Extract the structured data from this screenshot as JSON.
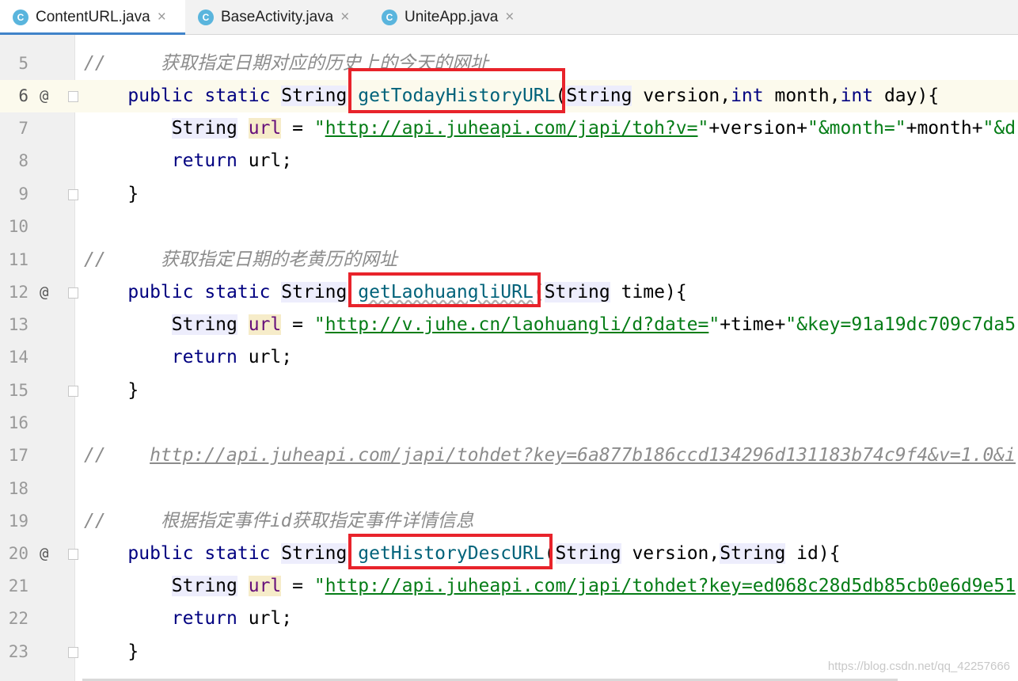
{
  "tabs": [
    {
      "label": "ContentURL.java",
      "icon": "c-class-icon",
      "active": true
    },
    {
      "label": "BaseActivity.java",
      "icon": "c-class-icon",
      "active": false
    },
    {
      "label": "UniteApp.java",
      "icon": "c-class-icon",
      "active": false
    }
  ],
  "tab_icon_letter": "C",
  "close_glyph": "×",
  "override_marker": "@",
  "line_numbers": [
    "5",
    "6",
    "7",
    "8",
    "9",
    "10",
    "11",
    "12",
    "13",
    "14",
    "15",
    "16",
    "17",
    "18",
    "19",
    "20",
    "21",
    "22",
    "23"
  ],
  "code": {
    "l5_comment_slashes": "//",
    "l5_comment_text": "获取指定日期对应的历史上的今天的网址",
    "l6_public": "public",
    "l6_static": "static",
    "l6_string": "String",
    "l6_method": "getTodayHistoryURL",
    "l6_paren": "(",
    "l6_param_type": "String",
    "l6_params_rest": " version,",
    "l6_int1": "int",
    "l6_month": " month,",
    "l6_int2": "int",
    "l6_day": " day){",
    "l7_type": "String",
    "l7_var": "url",
    "l7_eq": " = ",
    "l7_q1": "\"",
    "l7_link": "http://api.juheapi.com/japi/toh?v=",
    "l7_q2": "\"",
    "l7_rest1": "+version+",
    "l7_str2": "\"&month=\"",
    "l7_rest2": "+month+",
    "l7_str3": "\"&d",
    "l8_return": "return",
    "l8_rest": " url;",
    "close_brace": "}",
    "l11_comment_slashes": "//",
    "l11_comment_text": "获取指定日期的老黄历的网址",
    "l12_public": "public",
    "l12_static": "static",
    "l12_string": "String",
    "l12_method": "getLaohuangliURL",
    "l12_paren": "(",
    "l12_param_type": "String",
    "l12_rest": " time){",
    "l13_type": "String",
    "l13_var": "url",
    "l13_eq": " = ",
    "l13_q1": "\"",
    "l13_link": "http://v.juhe.cn/laohuangli/d?date=",
    "l13_q2": "\"",
    "l13_rest1": "+time+",
    "l13_str2": "\"&key=91a19dc709c7da5",
    "l14_return": "return",
    "l14_rest": " url;",
    "l17_comment_slashes": "//",
    "l17_comment_link": "http://api.juheapi.com/japi/tohdet?key=6a877b186ccd134296d131183b74c9f4&v=1.0&i",
    "l19_comment_slashes": "//",
    "l19_comment_text": "根据指定事件id获取指定事件详情信息",
    "l20_public": "public",
    "l20_static": "static",
    "l20_string": "String",
    "l20_method": "getHistoryDescURL",
    "l20_paren": "(",
    "l20_param_type": "String",
    "l20_rest1": " version,",
    "l20_param_type2": "String",
    "l20_rest2": " id){",
    "l21_type": "String",
    "l21_var": "url",
    "l21_eq": " = ",
    "l21_q1": "\"",
    "l21_link": "http://api.juheapi.com/japi/tohdet?key=ed068c28d5db85cb0e6d9e51",
    "l22_return": "return",
    "l22_rest": " url;"
  },
  "watermark": "https://blog.csdn.net/qq_42257666",
  "colors": {
    "keyword": "#000080",
    "string": "#067d17",
    "comment": "#8c8c8c",
    "method": "#00627a",
    "highlight_box": "#e8232b",
    "tab_accent": "#4083c9"
  }
}
